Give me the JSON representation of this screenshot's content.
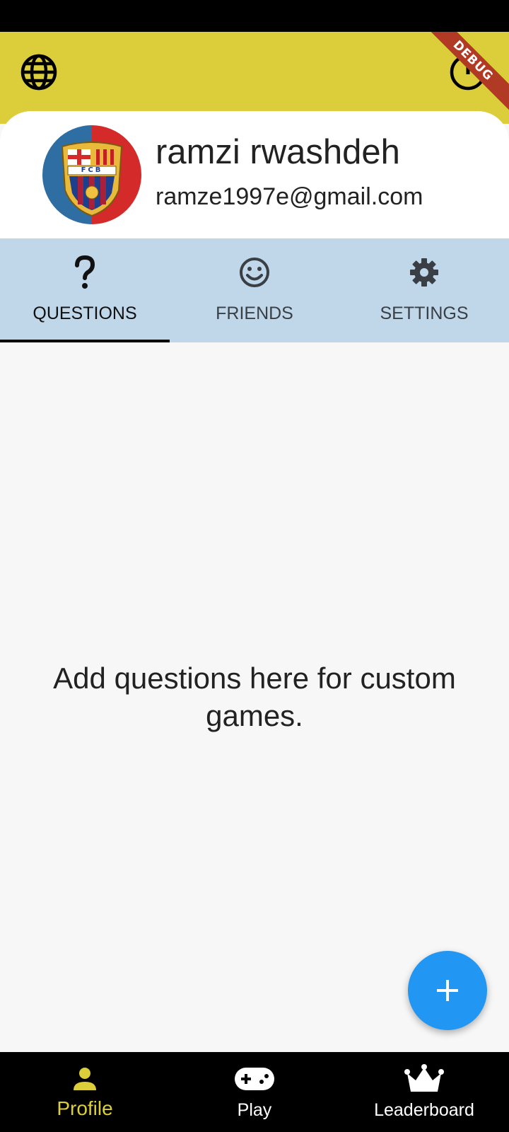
{
  "header": {
    "globe_icon": "globe-icon",
    "logout_icon": "power-icon",
    "debug_label": "DEBUG"
  },
  "profile": {
    "name": "ramzi rwashdeh",
    "email": "ramze1997e@gmail.com",
    "avatar_text": "FCB"
  },
  "tabs": [
    {
      "label": "QUESTIONS",
      "icon": "question-mark-icon"
    },
    {
      "label": "FRIENDS",
      "icon": "smiley-icon"
    },
    {
      "label": "SETTINGS",
      "icon": "gear-icon"
    }
  ],
  "main": {
    "empty_message": "Add questions here for custom games."
  },
  "fab": {
    "icon": "plus-icon"
  },
  "bottom_nav": [
    {
      "label": "Profile",
      "icon": "person-icon"
    },
    {
      "label": "Play",
      "icon": "gamepad-icon"
    },
    {
      "label": "Leaderboard",
      "icon": "crown-icon"
    }
  ],
  "colors": {
    "accent_yellow": "#dccd3a",
    "tab_bar_bg": "#c0d7ea",
    "fab_blue": "#2196f3",
    "debug_red": "#b13a24"
  }
}
